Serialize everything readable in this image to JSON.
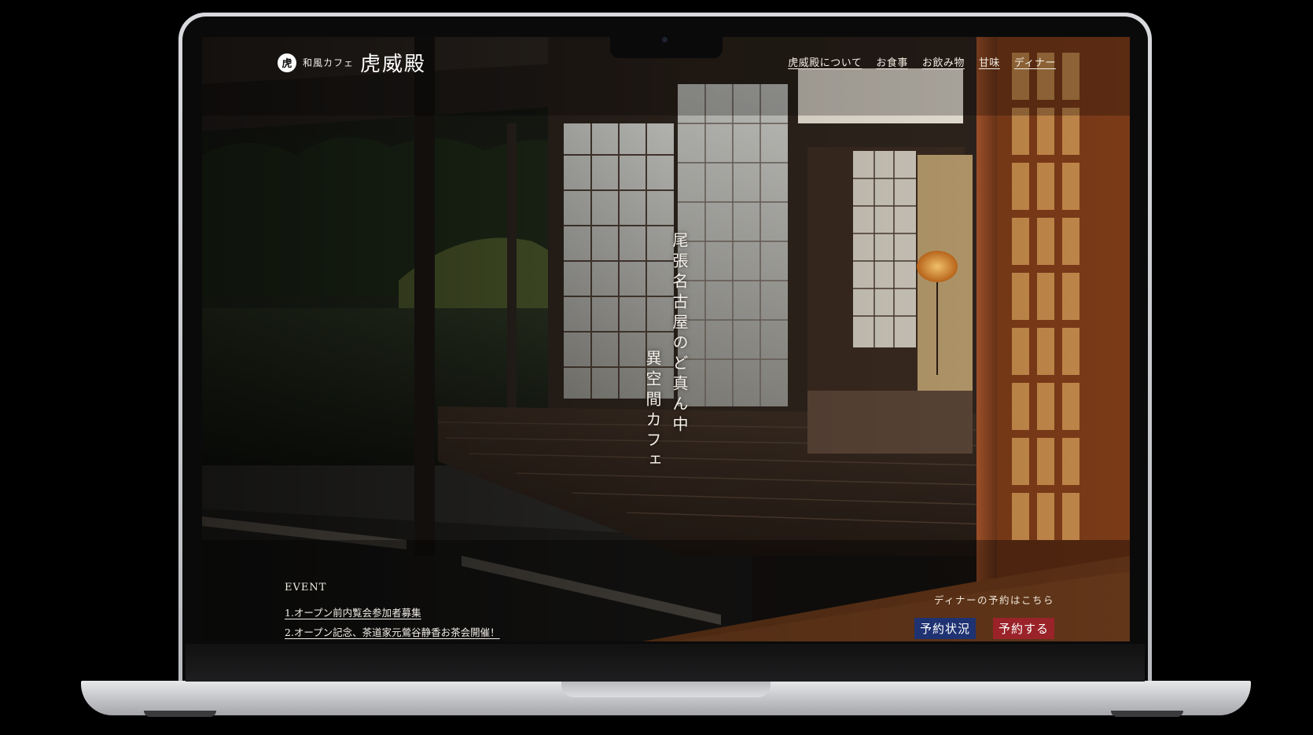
{
  "brand": {
    "icon_text": "虎",
    "sub": "和風カフェ",
    "name": "虎威殿"
  },
  "nav": [
    {
      "label": "虎威殿について"
    },
    {
      "label": "お食事"
    },
    {
      "label": "お飲み物"
    },
    {
      "label": "甘味"
    },
    {
      "label": "ディナー"
    }
  ],
  "hero": {
    "line1": "尾張名古屋のど真ん中",
    "line2": "異空間カフェ"
  },
  "event": {
    "heading": "EVENT",
    "items": [
      {
        "label": "1.オープン前内覧会参加者募集"
      },
      {
        "label": "2.オープン記念、茶道家元鶯谷静香お茶会開催！"
      }
    ]
  },
  "reservation": {
    "note": "ディナーの予約はこちら",
    "status_label": "予約状況",
    "book_label": "予約する"
  },
  "colors": {
    "status_button": "#1f3272",
    "book_button": "#9a2329"
  }
}
